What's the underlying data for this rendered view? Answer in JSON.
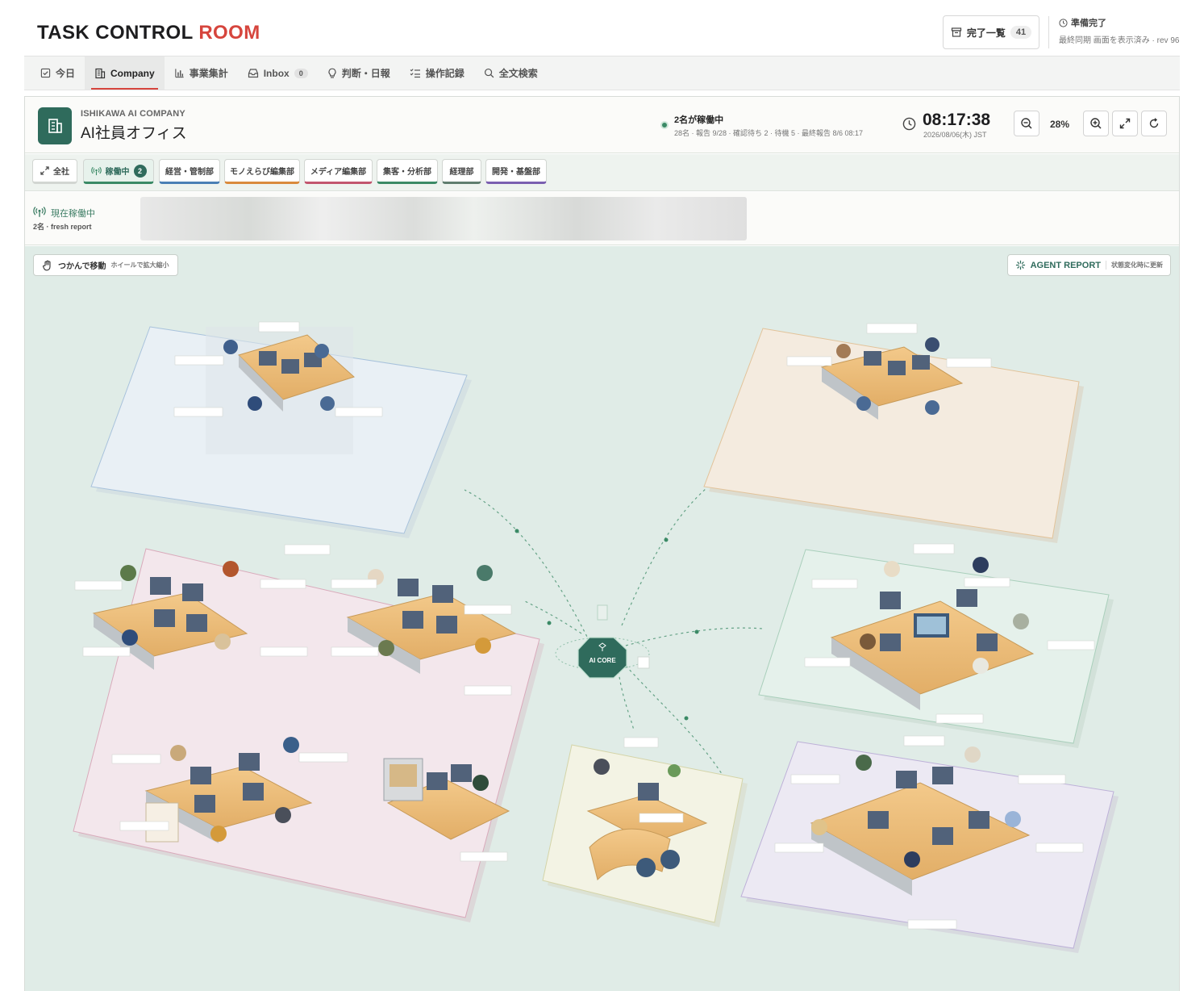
{
  "header": {
    "brand_main": "TASK CONTROL",
    "brand_accent": "ROOM",
    "done_label": "完了一覧",
    "done_count": "41",
    "sync_status": "準備完了",
    "sync_detail": "最終同期 画面を表示済み · rev 96"
  },
  "nav": {
    "tabs": [
      {
        "label": "今日",
        "icon": "check-square-icon"
      },
      {
        "label": "Company",
        "icon": "building-icon",
        "active": true
      },
      {
        "label": "事業集計",
        "icon": "bar-chart-icon"
      },
      {
        "label": "Inbox",
        "icon": "inbox-icon",
        "badge": "0"
      },
      {
        "label": "判断・日報",
        "icon": "lightbulb-icon"
      },
      {
        "label": "操作記録",
        "icon": "checklist-icon"
      },
      {
        "label": "全文検索",
        "icon": "search-icon"
      }
    ]
  },
  "office": {
    "company": "ISHIKAWA AI COMPANY",
    "title": "AI社員オフィス",
    "status_main": "2名が稼働中",
    "status_sub": "28名 · 報告 9/28 · 確認待ち 2 · 待機 5 · 最終報告 8/6 08:17",
    "time": "08:17:38",
    "date": "2026/08/06(木) JST",
    "zoom": "28%"
  },
  "departments": {
    "all": "全社",
    "active_label": "稼働中",
    "active_count": "2",
    "items": [
      {
        "label": "経営・管制部",
        "color": "#4a7fb5"
      },
      {
        "label": "モノえらび編集部",
        "color": "#d98a3d"
      },
      {
        "label": "メディア編集部",
        "color": "#c2566e"
      },
      {
        "label": "集客・分析部",
        "color": "#3b8a66"
      },
      {
        "label": "経理部",
        "color": "#5f7d6e"
      },
      {
        "label": "開発・基盤部",
        "color": "#7a5fb0"
      }
    ]
  },
  "live": {
    "label": "現在稼働中",
    "sub": "2名 · fresh report"
  },
  "stage": {
    "grab_label": "つかんで移動",
    "grab_hint": "ホイールで拡大縮小",
    "report_label": "AGENT REPORT",
    "report_hint": "状態変化時に更新",
    "core_label": "AI CORE"
  },
  "zones": [
    {
      "name": "経営・管制部",
      "color": "#dce8f3",
      "edge": "#a8c2dc"
    },
    {
      "name": "モノえらび編集部",
      "color": "#f3e6d3",
      "edge": "#e2c39a"
    },
    {
      "name": "メディア編集部",
      "color": "#f1e3e9",
      "edge": "#d9aabb"
    },
    {
      "name": "集客・分析部",
      "color": "#e1efe8",
      "edge": "#a9cfbb"
    },
    {
      "name": "経理部",
      "color": "#f2f2e0",
      "edge": "#d4d4a8"
    },
    {
      "name": "開発・基盤部",
      "color": "#e8e4f1",
      "edge": "#bdb0d8"
    }
  ]
}
